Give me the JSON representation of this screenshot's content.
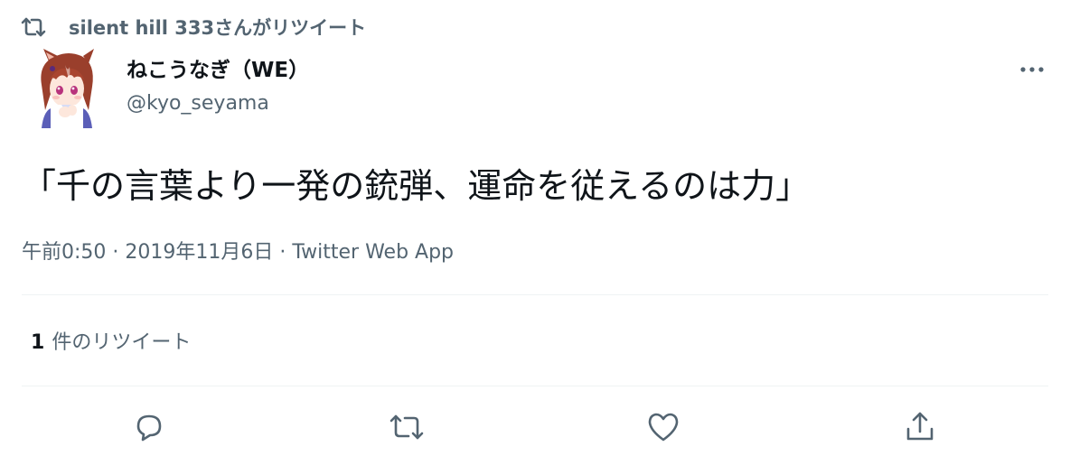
{
  "retweet_context": {
    "text": "silent hill 333さんがリツイート",
    "icon": "retweet-icon"
  },
  "author": {
    "display_name": "ねこうなぎ（WE）",
    "handle": "@kyo_seyama",
    "avatar": "anime-horse-girl-avatar"
  },
  "tweet": {
    "text": "「千の言葉より一発の銃弾、運命を従えるのは力」"
  },
  "meta": {
    "time": "午前0:50",
    "separator1": " · ",
    "date": "2019年11月6日",
    "separator2": " · ",
    "source": "Twitter Web App"
  },
  "stats": {
    "retweet_count": "1",
    "retweet_label": "件のリツイート"
  },
  "actions": {
    "reply_icon": "reply-icon",
    "retweet_icon": "retweet-icon",
    "like_icon": "heart-icon",
    "share_icon": "share-icon",
    "more_icon": "more-icon"
  },
  "colors": {
    "primary_text": "#0f1419",
    "secondary_text": "#536471",
    "divider": "#eff3f4"
  }
}
